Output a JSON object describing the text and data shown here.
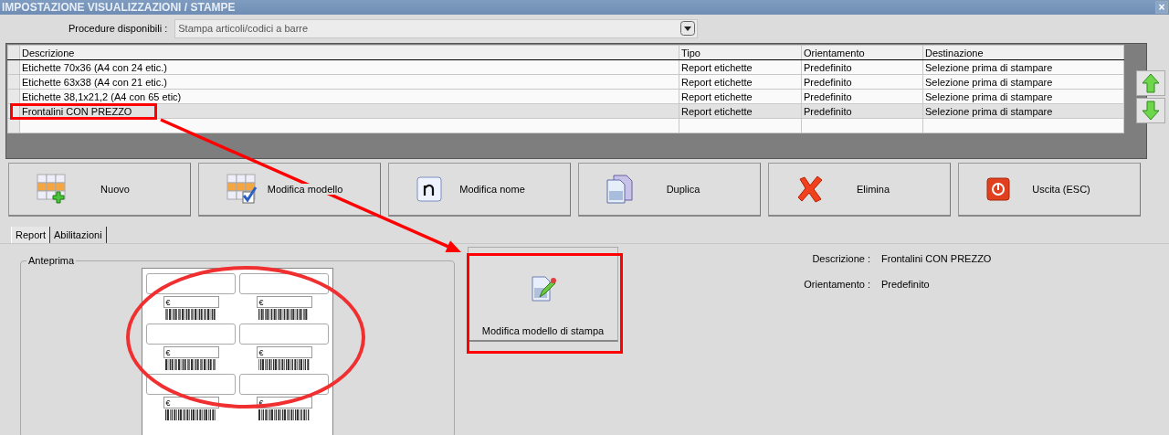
{
  "window": {
    "title": "IMPOSTAZIONE VISUALIZZAZIONI / STAMPE",
    "close": "×"
  },
  "procedure": {
    "label": "Procedure disponibili :",
    "value": "Stampa articoli/codici a barre"
  },
  "table": {
    "columns": [
      "Descrizione",
      "Tipo",
      "Orientamento",
      "Destinazione"
    ],
    "rows": [
      {
        "cells": [
          "Etichette 70x36 (A4 con 24 etic.)",
          "Report etichette",
          "Predefinito",
          "Selezione prima di stampare"
        ],
        "selected": false
      },
      {
        "cells": [
          "Etichette 63x38 (A4 con 21 etic.)",
          "Report etichette",
          "Predefinito",
          "Selezione prima di stampare"
        ],
        "selected": false
      },
      {
        "cells": [
          "Etichette 38,1x21,2 (A4 con 65 etic)",
          "Report etichette",
          "Predefinito",
          "Selezione prima di stampare"
        ],
        "selected": false
      },
      {
        "cells": [
          "Frontalini CON PREZZO",
          "Report etichette",
          "Predefinito",
          "Selezione prima di stampare"
        ],
        "selected": true
      }
    ]
  },
  "toolbar": [
    {
      "label": "Nuovo",
      "kind": "new"
    },
    {
      "label": "Modifica modello",
      "kind": "edit-model"
    },
    {
      "label": "Modifica nome",
      "kind": "rename"
    },
    {
      "label": "Duplica",
      "kind": "duplicate"
    },
    {
      "label": "Elimina",
      "kind": "delete"
    },
    {
      "label": "Uscita (ESC)",
      "kind": "exit"
    }
  ],
  "tabs": [
    {
      "label": "Report",
      "selected": true
    },
    {
      "label": "Abilitazioni",
      "selected": false
    }
  ],
  "preview": {
    "title": "Anteprima",
    "labels": [
      {
        "price": "€"
      },
      {
        "price": "€"
      },
      {
        "price": "€"
      },
      {
        "price": "€"
      },
      {
        "price": "€"
      },
      {
        "price": "€"
      }
    ]
  },
  "edit_button": {
    "label": "Modifica modello di stampa"
  },
  "details": [
    {
      "label": "Descrizione :",
      "value": "Frontalini CON PREZZO"
    },
    {
      "label": "Orientamento :",
      "value": "Predefinito"
    }
  ]
}
